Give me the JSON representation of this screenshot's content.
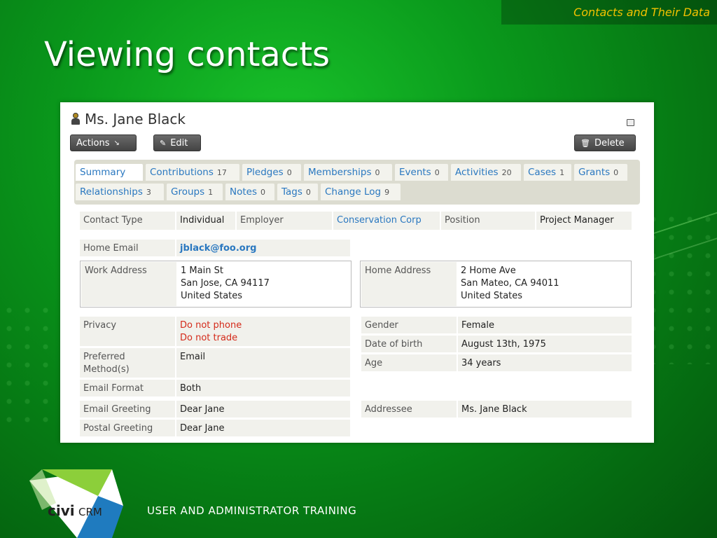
{
  "header": {
    "section": "Contacts and Their Data"
  },
  "slide": {
    "title": "Viewing contacts",
    "footer": "USER AND ADMINISTRATOR TRAINING"
  },
  "logo": {
    "text_civi": "civi",
    "text_crm": "CRM"
  },
  "contact": {
    "name": "Ms. Jane Black",
    "icons": {
      "person": "person-icon",
      "print": "print-icon",
      "edit": "pencil-icon",
      "delete": "trash-icon",
      "actions": "arrow-icon"
    }
  },
  "buttons": {
    "actions": "Actions",
    "edit": "Edit",
    "delete": "Delete"
  },
  "tabs": [
    {
      "label": "Summary",
      "count": ""
    },
    {
      "label": "Contributions",
      "count": "17"
    },
    {
      "label": "Pledges",
      "count": "0"
    },
    {
      "label": "Memberships",
      "count": "0"
    },
    {
      "label": "Events",
      "count": "0"
    },
    {
      "label": "Activities",
      "count": "20"
    },
    {
      "label": "Cases",
      "count": "1"
    },
    {
      "label": "Grants",
      "count": "0"
    },
    {
      "label": "Relationships",
      "count": "3"
    },
    {
      "label": "Groups",
      "count": "1"
    },
    {
      "label": "Notes",
      "count": "0"
    },
    {
      "label": "Tags",
      "count": "0"
    },
    {
      "label": "Change Log",
      "count": "9"
    }
  ],
  "fields": {
    "contact_type_label": "Contact Type",
    "contact_type": "Individual",
    "employer_label": "Employer",
    "employer": "Conservation Corp",
    "position_label": "Position",
    "position": "Project Manager",
    "home_email_label": "Home Email",
    "home_email": "jblack@foo.org",
    "work_address_label": "Work Address",
    "work_address": [
      "1 Main St",
      "San Jose, CA 94117",
      "United States"
    ],
    "home_address_label": "Home Address",
    "home_address": [
      "2 Home Ave",
      "San Mateo, CA 94011",
      "United States"
    ],
    "privacy_label": "Privacy",
    "privacy": [
      "Do not phone",
      "Do not trade"
    ],
    "preferred_label": [
      "Preferred",
      "Method(s)"
    ],
    "preferred": "Email",
    "email_format_label": "Email Format",
    "email_format": "Both",
    "gender_label": "Gender",
    "gender": "Female",
    "dob_label": "Date of birth",
    "dob": "August 13th, 1975",
    "age_label": "Age",
    "age": "34 years",
    "email_greeting_label": "Email Greeting",
    "email_greeting": "Dear Jane",
    "postal_greeting_label": "Postal Greeting",
    "postal_greeting": "Dear Jane",
    "addressee_label": "Addressee",
    "addressee": "Ms. Jane Black"
  },
  "colors": {
    "accent": "#f2c200",
    "link": "#2a78c0",
    "warning": "#d42a1a"
  }
}
